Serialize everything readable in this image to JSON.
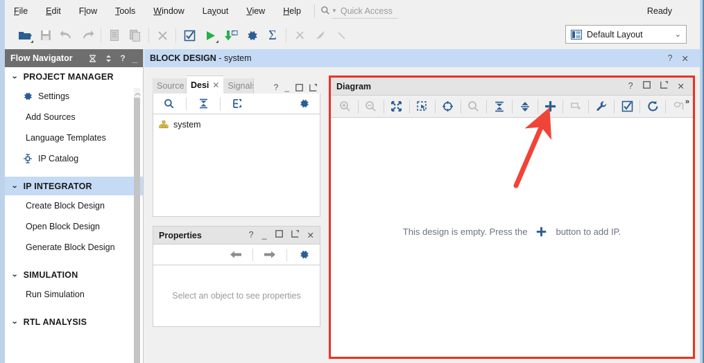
{
  "menubar": {
    "items": [
      {
        "label": "File",
        "accel": "F"
      },
      {
        "label": "Edit",
        "accel": "E"
      },
      {
        "label": "Flow",
        "accel": "l"
      },
      {
        "label": "Tools",
        "accel": "T"
      },
      {
        "label": "Window",
        "accel": "W"
      },
      {
        "label": "Layout",
        "accel": "y"
      },
      {
        "label": "View",
        "accel": "V"
      },
      {
        "label": "Help",
        "accel": "H"
      }
    ],
    "quick_access_placeholder": "Quick Access",
    "quick_access_value": "",
    "status": "Ready"
  },
  "toolbar": {
    "buttons": [
      {
        "name": "open-project-icon",
        "title": "Open Project"
      },
      {
        "name": "save-icon",
        "title": "Save"
      },
      {
        "name": "undo-icon",
        "title": "Undo"
      },
      {
        "name": "redo-icon",
        "title": "Redo"
      },
      {
        "name": "copy-icon",
        "title": "Copy"
      },
      {
        "name": "paste-icon",
        "title": "Paste"
      },
      {
        "name": "close-x-icon",
        "title": "Close"
      },
      {
        "name": "validate-check-icon",
        "title": "Validate Design"
      },
      {
        "name": "run-play-icon",
        "title": "Run"
      },
      {
        "name": "program-download-icon",
        "title": "Program Device"
      },
      {
        "name": "settings-gear-icon",
        "title": "Settings"
      },
      {
        "name": "sum-sigma-icon",
        "title": "Report"
      },
      {
        "name": "disabled-cross-icon",
        "title": "Disabled"
      },
      {
        "name": "disabled-slash-icon",
        "title": "Disabled"
      }
    ],
    "layout_label": "Default Layout"
  },
  "flow_navigator": {
    "title": "Flow Navigator",
    "header_icons": [
      "collapse-all-icon",
      "expand-all-icon",
      "help-icon",
      "minimize-icon"
    ],
    "sections": [
      {
        "name": "PROJECT MANAGER",
        "selected": false,
        "items": [
          {
            "label": "Settings",
            "icon": "gear-icon"
          },
          {
            "label": "Add Sources",
            "icon": null
          },
          {
            "label": "Language Templates",
            "icon": null
          },
          {
            "label": "IP Catalog",
            "icon": "ip-catalog-icon"
          }
        ]
      },
      {
        "name": "IP INTEGRATOR",
        "selected": true,
        "items": [
          {
            "label": "Create Block Design",
            "icon": null
          },
          {
            "label": "Open Block Design",
            "icon": null
          },
          {
            "label": "Generate Block Design",
            "icon": null
          }
        ]
      },
      {
        "name": "SIMULATION",
        "selected": false,
        "items": [
          {
            "label": "Run Simulation",
            "icon": null
          }
        ]
      },
      {
        "name": "RTL ANALYSIS",
        "selected": false,
        "items": []
      }
    ]
  },
  "block_design": {
    "title_bold": "BLOCK DESIGN",
    "title_rest": " - system",
    "header_icons": [
      "help-icon",
      "close-icon"
    ]
  },
  "sources_panel": {
    "tabs": [
      {
        "label": "Source",
        "active": false,
        "clipped": true
      },
      {
        "label": "Desi",
        "active": true,
        "clipped": false
      },
      {
        "label": "Signals",
        "active": false,
        "clipped": true
      }
    ],
    "tab_icons": [
      "help-icon",
      "minimize-icon",
      "maximize-icon",
      "float-icon"
    ],
    "toolbar_icons": [
      "search-icon",
      "collapse-all-icon",
      "expand-hier-icon",
      "settings-gear-icon"
    ],
    "tree": [
      {
        "label": "system",
        "icon": "design-hierarchy-icon"
      }
    ]
  },
  "properties_panel": {
    "title": "Properties",
    "header_icons": [
      "help-icon",
      "minimize-icon",
      "maximize-icon",
      "float-icon",
      "close-icon"
    ],
    "toolbar_icons": [
      "back-arrow-icon",
      "forward-arrow-icon",
      "settings-gear-icon"
    ],
    "empty_text": "Select an object to see properties"
  },
  "diagram_panel": {
    "title": "Diagram",
    "header_icons": [
      "help-icon",
      "maximize-icon",
      "float-icon",
      "close-icon"
    ],
    "toolbar_icons": [
      {
        "name": "zoom-in-icon",
        "enabled": false
      },
      {
        "name": "zoom-out-icon",
        "enabled": false
      },
      {
        "name": "fit-screen-icon",
        "enabled": true
      },
      {
        "name": "zoom-area-icon",
        "enabled": true
      },
      {
        "name": "highlight-target-icon",
        "enabled": true
      },
      {
        "name": "search-icon",
        "enabled": false
      },
      {
        "name": "collapse-all-icon",
        "enabled": true
      },
      {
        "name": "expand-all-icon",
        "enabled": true
      },
      {
        "name": "add-ip-plus-icon",
        "enabled": true
      },
      {
        "name": "add-module-icon",
        "enabled": false
      },
      {
        "name": "run-connection-automation-wrench-icon",
        "enabled": true
      },
      {
        "name": "validate-design-check-icon",
        "enabled": true
      },
      {
        "name": "regenerate-layout-icon",
        "enabled": true
      },
      {
        "name": "optimize-routing-icon",
        "enabled": false
      }
    ],
    "more_label": "»",
    "empty_message_pre": "This design is empty. Press the",
    "empty_message_icon": "plus-icon",
    "empty_message_post": "button to add IP."
  },
  "annotation": {
    "arrow_color": "#f04438",
    "highlight_border_color": "#ee3124"
  }
}
